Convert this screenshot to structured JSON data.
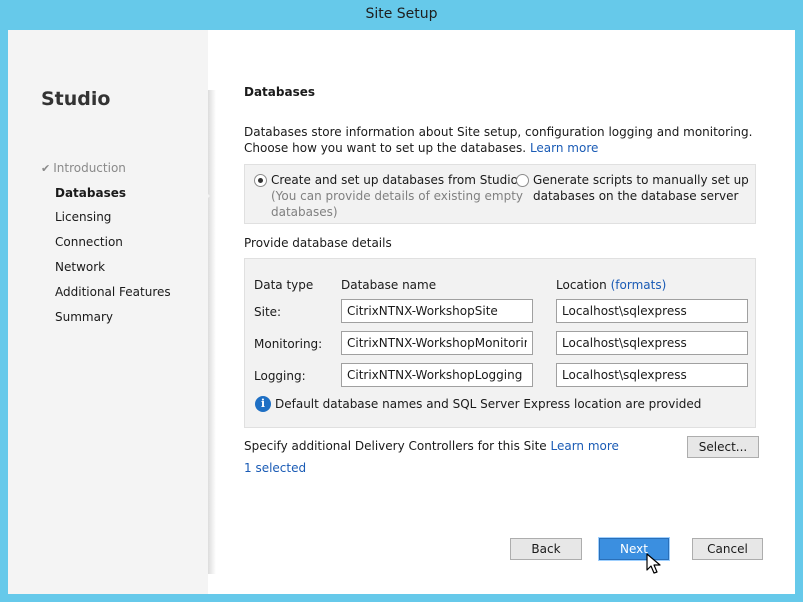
{
  "window": {
    "title": "Site Setup"
  },
  "sidebar": {
    "title": "Studio",
    "items": [
      {
        "label": "Introduction",
        "state": "done"
      },
      {
        "label": "Databases",
        "state": "active"
      },
      {
        "label": "Licensing",
        "state": "pending"
      },
      {
        "label": "Connection",
        "state": "pending"
      },
      {
        "label": "Network",
        "state": "pending"
      },
      {
        "label": "Additional Features",
        "state": "pending"
      },
      {
        "label": "Summary",
        "state": "pending"
      }
    ]
  },
  "main": {
    "heading": "Databases",
    "description_line1": "Databases store information about Site setup, configuration logging and monitoring.",
    "description_line2": "Choose how you want to set up the databases.",
    "learn_more": "Learn more",
    "options": {
      "studio": {
        "label": "Create and set up databases from Studio",
        "sub_line1": "(You can provide details of existing empty",
        "sub_line2": "databases)",
        "selected": true
      },
      "scripts": {
        "label_line1": "Generate scripts to manually set up",
        "label_line2": "databases on the database server",
        "selected": false
      }
    },
    "details_label": "Provide database details",
    "table": {
      "headers": {
        "data_type": "Data type",
        "db_name": "Database name",
        "location": "Location",
        "formats_link": "(formats)"
      },
      "rows": [
        {
          "label": "Site:",
          "db_name": "CitrixNTNX-WorkshopSite",
          "location": "Localhost\\sqlexpress"
        },
        {
          "label": "Monitoring:",
          "db_name": "CitrixNTNX-WorkshopMonitoring",
          "location": "Localhost\\sqlexpress"
        },
        {
          "label": "Logging:",
          "db_name": "CitrixNTNX-WorkshopLogging",
          "location": "Localhost\\sqlexpress"
        }
      ],
      "info": "Default database names and SQL Server Express location are provided"
    },
    "controllers_text": "Specify additional Delivery Controllers for this Site",
    "controllers_learn_more": "Learn more",
    "select_button": "Select...",
    "selected_count": "1 selected"
  },
  "footer": {
    "back": "Back",
    "next": "Next",
    "cancel": "Cancel"
  },
  "colors": {
    "frame": "#66c9ea",
    "link": "#1a5bb5",
    "primary_button": "#3b8fe0",
    "info_icon": "#1e6fc4"
  },
  "icons": {
    "check": "check-icon",
    "info": "info-icon",
    "cursor": "mouse-cursor-icon"
  }
}
